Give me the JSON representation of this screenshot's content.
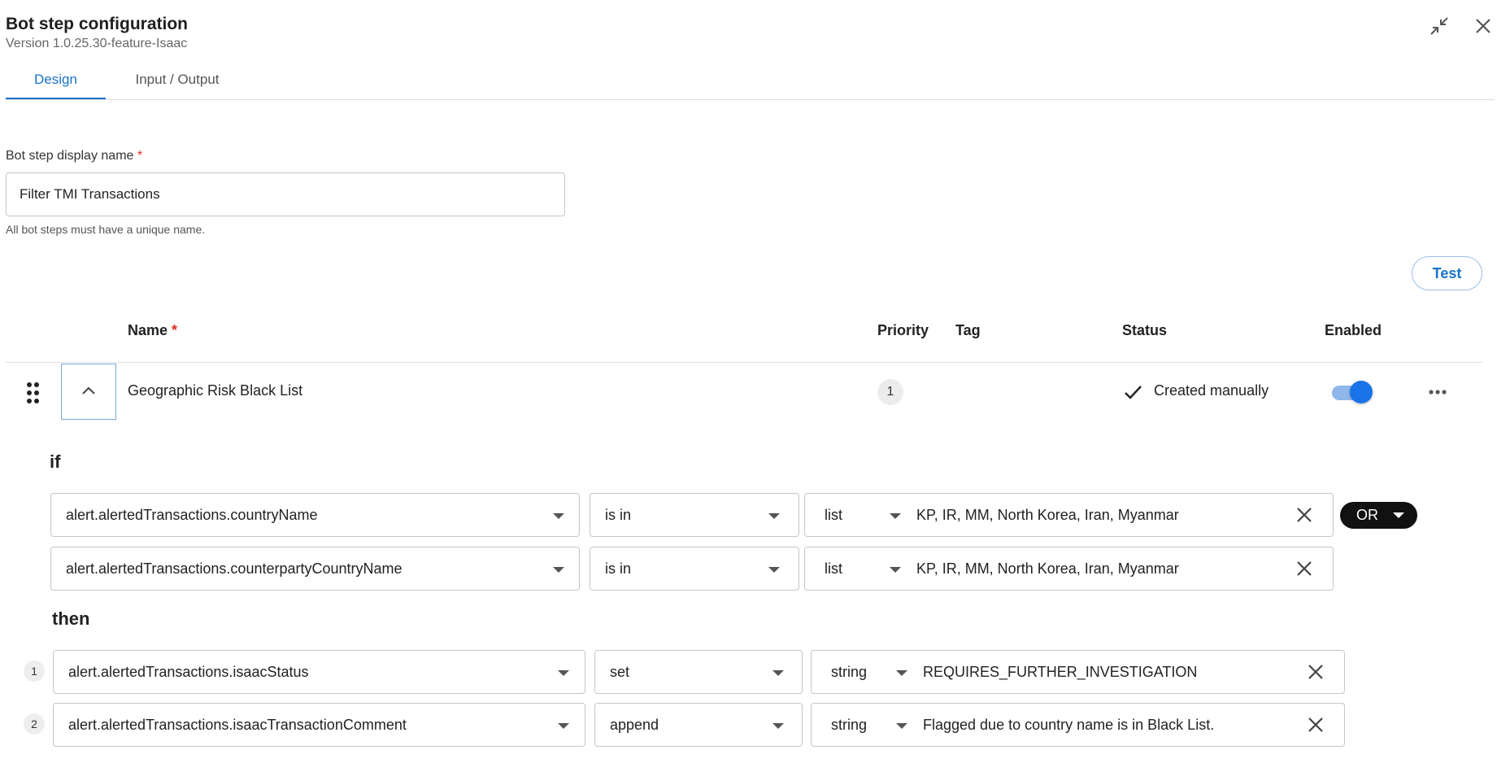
{
  "header": {
    "title": "Bot step configuration",
    "version": "Version 1.0.25.30-feature-Isaac",
    "icons": [
      "collapse-arrows-icon",
      "close-icon"
    ]
  },
  "tabs": [
    {
      "label": "Design",
      "active": true
    },
    {
      "label": "Input / Output",
      "active": false
    }
  ],
  "form": {
    "display_name_label": "Bot step display name",
    "required_mark": "*",
    "display_name_value": "Filter TMI Transactions",
    "hint": "All bot steps must have a unique name."
  },
  "test_button": "Test",
  "table": {
    "columns": {
      "name": "Name",
      "name_required": "*",
      "priority": "Priority",
      "tag": "Tag",
      "status": "Status",
      "enabled": "Enabled"
    },
    "rule": {
      "name": "Geographic Risk Black List",
      "priority": "1",
      "tag": "",
      "status": "Created manually",
      "enabled": true,
      "expanded": true
    }
  },
  "conditions": {
    "if_label": "if",
    "then_label": "then",
    "logic_operator": "OR",
    "if_rows": [
      {
        "field": "alert.alertedTransactions.countryName",
        "operator": "is in",
        "type": "list",
        "value": "KP, IR, MM, North Korea, Iran, Myanmar"
      },
      {
        "field": "alert.alertedTransactions.counterpartyCountryName",
        "operator": "is in",
        "type": "list",
        "value": "KP, IR, MM, North Korea, Iran, Myanmar"
      }
    ],
    "then_rows": [
      {
        "index": "1",
        "field": "alert.alertedTransactions.isaacStatus",
        "action": "set",
        "type": "string",
        "value": "REQUIRES_FURTHER_INVESTIGATION"
      },
      {
        "index": "2",
        "field": "alert.alertedTransactions.isaacTransactionComment",
        "action": "append",
        "type": "string",
        "value": "Flagged due to country name is in Black List."
      }
    ]
  },
  "colors": {
    "accent": "#1a73c8",
    "toggle_on": "#1a73e8",
    "required": "#d93025",
    "or_button_bg": "#111111"
  }
}
